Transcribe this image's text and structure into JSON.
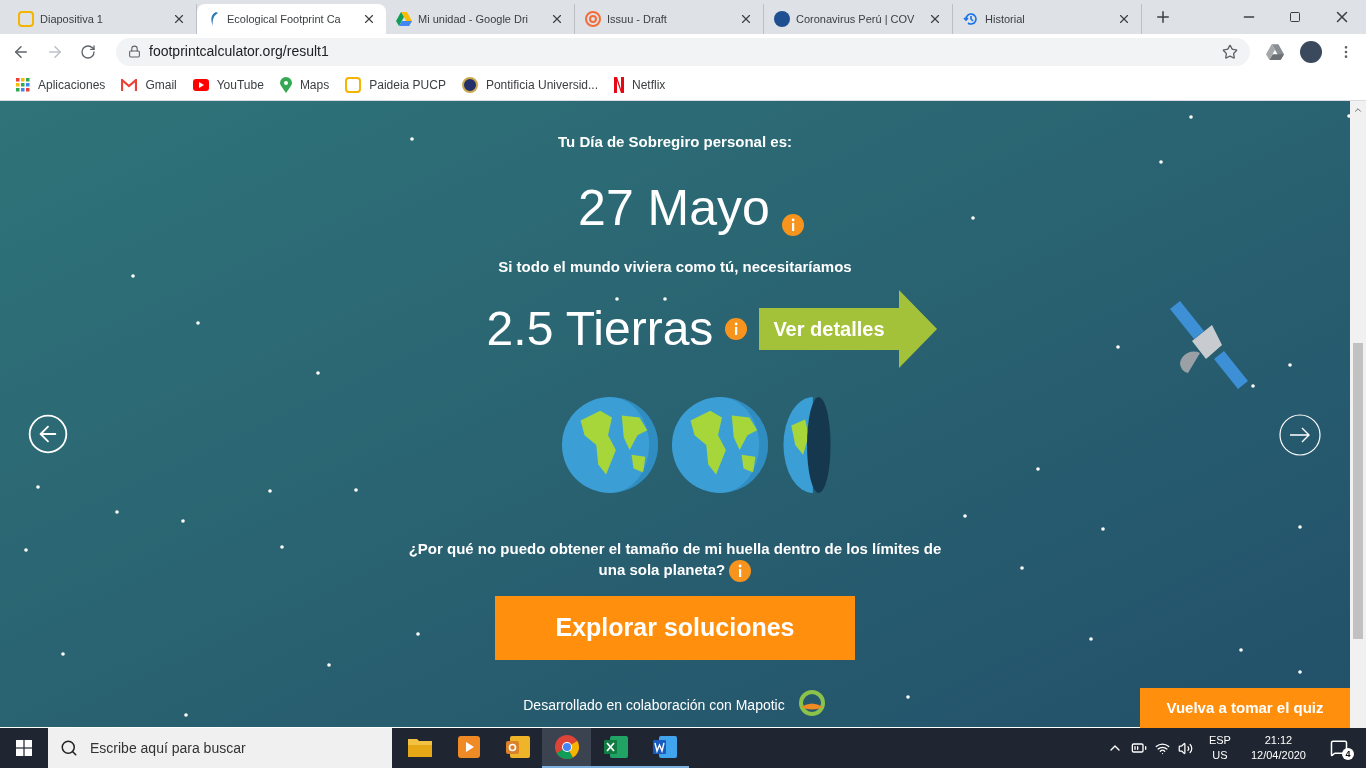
{
  "browser": {
    "tabs": [
      {
        "title": "Diapositiva 1",
        "kind": "slides",
        "selected": false
      },
      {
        "title": "Ecological Footprint Ca",
        "kind": "footprint",
        "selected": true
      },
      {
        "title": "Mi unidad - Google Dri",
        "kind": "drive",
        "selected": false
      },
      {
        "title": "Issuu - Draft",
        "kind": "issuu",
        "selected": false
      },
      {
        "title": "Coronavirus Perú | COV",
        "kind": "p21",
        "selected": false
      },
      {
        "title": "Historial",
        "kind": "history",
        "selected": false
      }
    ],
    "url": "footprintcalculator.org/result1",
    "bookmarks": [
      {
        "label": "Aplicaciones",
        "kind": "apps"
      },
      {
        "label": "Gmail",
        "kind": "gmail"
      },
      {
        "label": "YouTube",
        "kind": "youtube"
      },
      {
        "label": "Maps",
        "kind": "maps"
      },
      {
        "label": "Paideia PUCP",
        "kind": "slides"
      },
      {
        "label": "Pontificia Universid...",
        "kind": "seal"
      },
      {
        "label": "Netflix",
        "kind": "netflix"
      }
    ]
  },
  "page": {
    "overshoot_heading": "Tu Día de Sobregiro personal es:",
    "overshoot_date": "27 Mayo",
    "earths_intro": "Si todo el mundo viviera como tú, necesitaríamos",
    "earths_count": "2.5 Tierras",
    "details_button": "Ver detalles",
    "globes": [
      {
        "kind": "full"
      },
      {
        "kind": "full"
      },
      {
        "kind": "half"
      }
    ],
    "question": "¿Por qué no puedo obtener el tamaño de mi huella dentro de los límites de una sola planeta?",
    "solutions_button": "Explorar soluciones",
    "credit": "Desarrollado en colaboración con Mapotic",
    "retake_button": "Vuelva a tomar el quiz"
  },
  "taskbar": {
    "search_placeholder": "Escribe aquí para buscar",
    "apps": [
      {
        "kind": "explorer",
        "selected": false
      },
      {
        "kind": "media",
        "selected": false
      },
      {
        "kind": "outlook",
        "selected": false
      },
      {
        "kind": "chrome",
        "selected": true
      },
      {
        "kind": "excel",
        "selected": false
      },
      {
        "kind": "word",
        "selected": false
      }
    ],
    "language": "ESP",
    "layout": "US",
    "time": "21:12",
    "date": "12/04/2020",
    "notifications": "4"
  }
}
